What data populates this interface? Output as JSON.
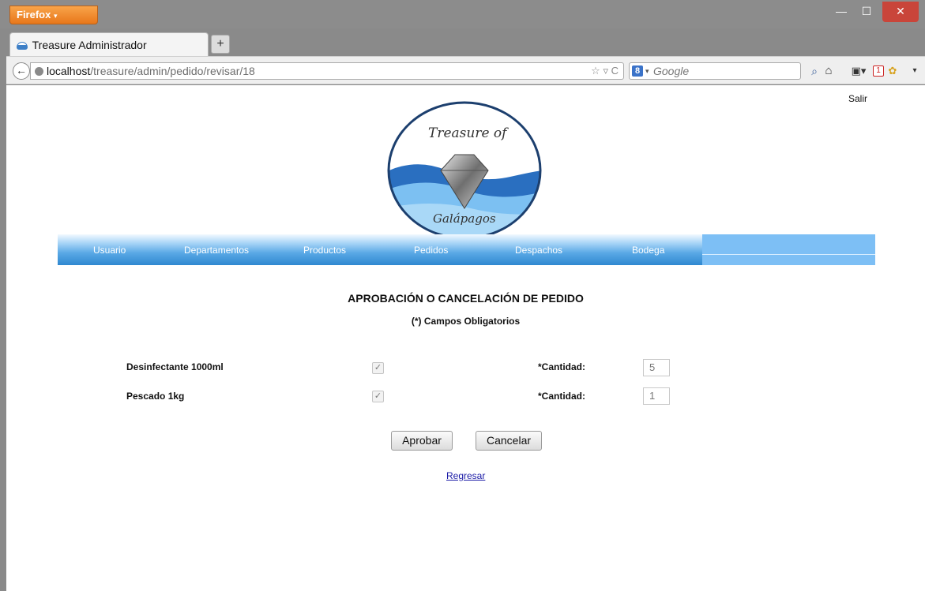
{
  "browser": {
    "menu_button": "Firefox",
    "tab_title": "Treasure Administrador",
    "new_tab_symbol": "+",
    "url_host": "localhost",
    "url_path": "/treasure/admin/pedido/revisar/18",
    "search_placeholder": "Google",
    "search_engine_badge": "8"
  },
  "header": {
    "logout_label": "Salir",
    "logo_text_top": "Treasure of",
    "logo_text_bottom": "Galápagos"
  },
  "nav": {
    "items": [
      "Usuario",
      "Departamentos",
      "Productos",
      "Pedidos",
      "Despachos",
      "Bodega"
    ]
  },
  "page": {
    "title": "APROBACIÓN O CANCELACIÓN DE PEDIDO",
    "required_note": "(*) Campos Obligatorios",
    "quantity_label": "*Cantidad:",
    "rows": [
      {
        "product": "Desinfectante 1000ml",
        "checked": true,
        "quantity": "5"
      },
      {
        "product": "Pescado 1kg",
        "checked": true,
        "quantity": "1"
      }
    ],
    "approve_button": "Aprobar",
    "cancel_button": "Cancelar",
    "back_link": "Regresar"
  },
  "colors": {
    "menu_bar": "#7dbff5",
    "link": "#1a1aa6",
    "firefox_button": "#e8771a",
    "close_button": "#c9453a"
  },
  "icons": [
    "back-arrow-icon",
    "globe-icon",
    "star-icon",
    "reload-icon",
    "search-icon",
    "home-icon",
    "bookmarks-icon",
    "extension-icon"
  ]
}
